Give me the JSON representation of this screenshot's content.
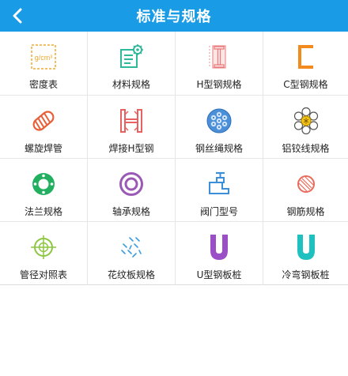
{
  "header": {
    "title": "标准与规格",
    "back_icon": "back-arrow-icon"
  },
  "colors": {
    "header_bg": "#1a9be6"
  },
  "items": [
    {
      "label": "密度表",
      "icon": "density-icon",
      "icon_text": "g/cm³"
    },
    {
      "label": "材料规格",
      "icon": "material-spec-icon"
    },
    {
      "label": "H型钢规格",
      "icon": "h-beam-icon"
    },
    {
      "label": "C型钢规格",
      "icon": "c-channel-icon"
    },
    {
      "label": "螺旋焊管",
      "icon": "spiral-pipe-icon"
    },
    {
      "label": "焊接H型钢",
      "icon": "welded-h-beam-icon"
    },
    {
      "label": "钢丝绳规格",
      "icon": "wire-rope-icon"
    },
    {
      "label": "铝铰线规格",
      "icon": "aluminum-strand-icon"
    },
    {
      "label": "法兰规格",
      "icon": "flange-icon"
    },
    {
      "label": "轴承规格",
      "icon": "bearing-icon"
    },
    {
      "label": "阀门型号",
      "icon": "valve-icon"
    },
    {
      "label": "钢筋规格",
      "icon": "rebar-icon"
    },
    {
      "label": "管径对照表",
      "icon": "pipe-diameter-icon"
    },
    {
      "label": "花纹板规格",
      "icon": "pattern-plate-icon"
    },
    {
      "label": "U型钢板桩",
      "icon": "u-sheet-pile-icon"
    },
    {
      "label": "冷弯钢板桩",
      "icon": "cold-formed-pile-icon"
    }
  ]
}
